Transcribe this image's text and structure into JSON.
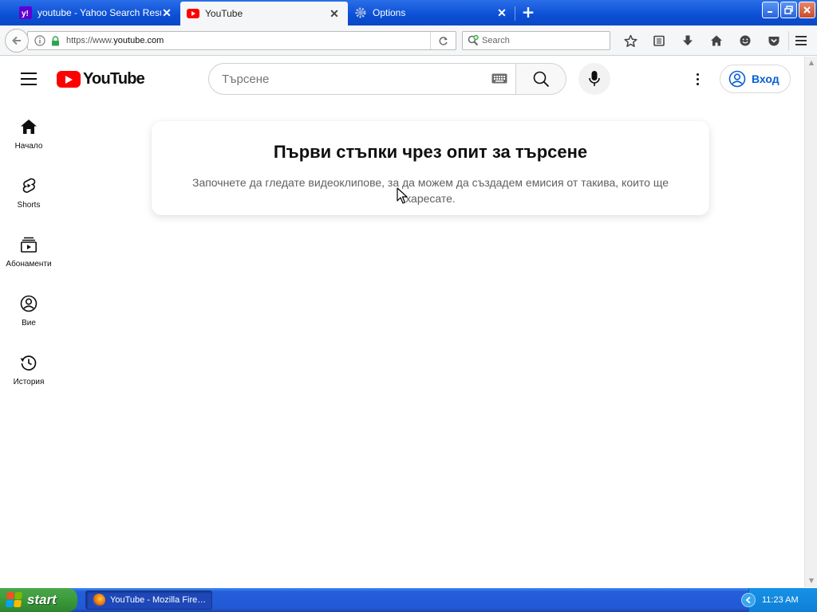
{
  "browser": {
    "tabs": [
      {
        "title": "youtube - Yahoo Search Resu…",
        "favicon": "yahoo-icon",
        "active": false
      },
      {
        "title": "YouTube",
        "favicon": "youtube-icon",
        "active": true
      },
      {
        "title": "Options",
        "favicon": "gear-icon",
        "active": false
      }
    ],
    "new_tab_label": "+",
    "url_prefix": "https://www.",
    "url_host": "youtube.com",
    "search_placeholder": "Search",
    "toolbar_icons": [
      "star-icon",
      "reading-list-icon",
      "download-icon",
      "home-icon",
      "smiley-icon",
      "pocket-icon"
    ],
    "accent": "#0b4fd6"
  },
  "youtube": {
    "logo_text": "YouTube",
    "search_placeholder": "Търсене",
    "sign_in_label": "Вход",
    "brand_color": "#ff0000",
    "link_color": "#065fd4",
    "guide": [
      {
        "label": "Начало",
        "icon": "home-icon"
      },
      {
        "label": "Shorts",
        "icon": "shorts-icon"
      },
      {
        "label": "Абонаменти",
        "icon": "subscriptions-icon"
      },
      {
        "label": "Вие",
        "icon": "account-icon"
      },
      {
        "label": "История",
        "icon": "history-icon"
      }
    ],
    "promo": {
      "title": "Първи стъпки чрез опит за търсене",
      "body": "Започнете да гледате видеоклипове, за да можем да създадем емисия от такива, които ще харесате."
    }
  },
  "taskbar": {
    "start_label": "start",
    "task_label": "YouTube - Mozilla Fire…",
    "clock": "11:23 AM"
  }
}
